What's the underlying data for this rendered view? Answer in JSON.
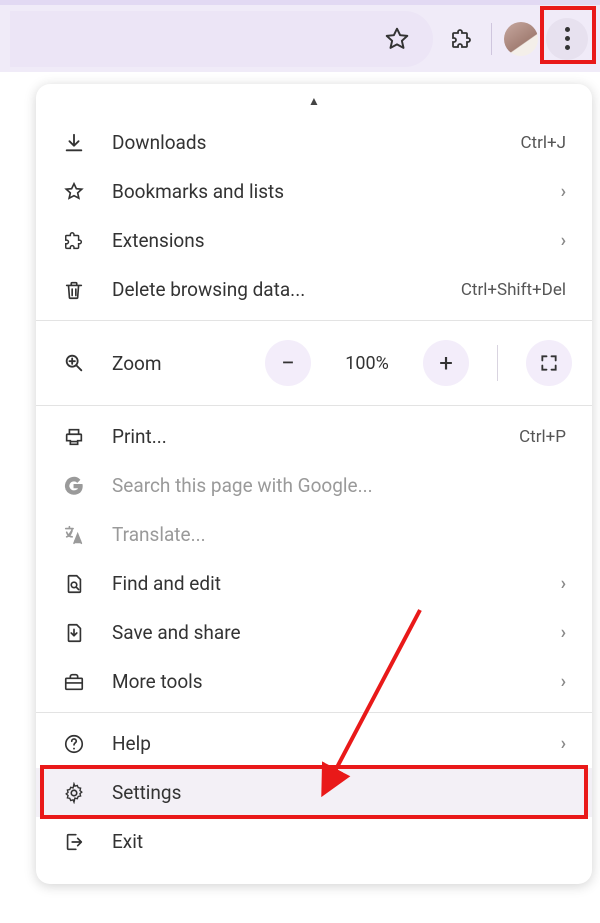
{
  "toolbar": {
    "star_tooltip": "Bookmark",
    "extensions_tooltip": "Extensions",
    "profile_tooltip": "Profile",
    "menu_tooltip": "Customize and control"
  },
  "menu": {
    "downloads": {
      "label": "Downloads",
      "shortcut": "Ctrl+J"
    },
    "bookmarks": {
      "label": "Bookmarks and lists"
    },
    "extensions": {
      "label": "Extensions"
    },
    "delete_data": {
      "label": "Delete browsing data...",
      "shortcut": "Ctrl+Shift+Del"
    },
    "zoom": {
      "label": "Zoom",
      "value": "100%"
    },
    "print": {
      "label": "Print...",
      "shortcut": "Ctrl+P"
    },
    "search_page": {
      "label": "Search this page with Google..."
    },
    "translate": {
      "label": "Translate..."
    },
    "find_edit": {
      "label": "Find and edit"
    },
    "save_share": {
      "label": "Save and share"
    },
    "more_tools": {
      "label": "More tools"
    },
    "help": {
      "label": "Help"
    },
    "settings": {
      "label": "Settings"
    },
    "exit": {
      "label": "Exit"
    }
  },
  "annotation": {
    "highlight_color": "#e91919"
  }
}
